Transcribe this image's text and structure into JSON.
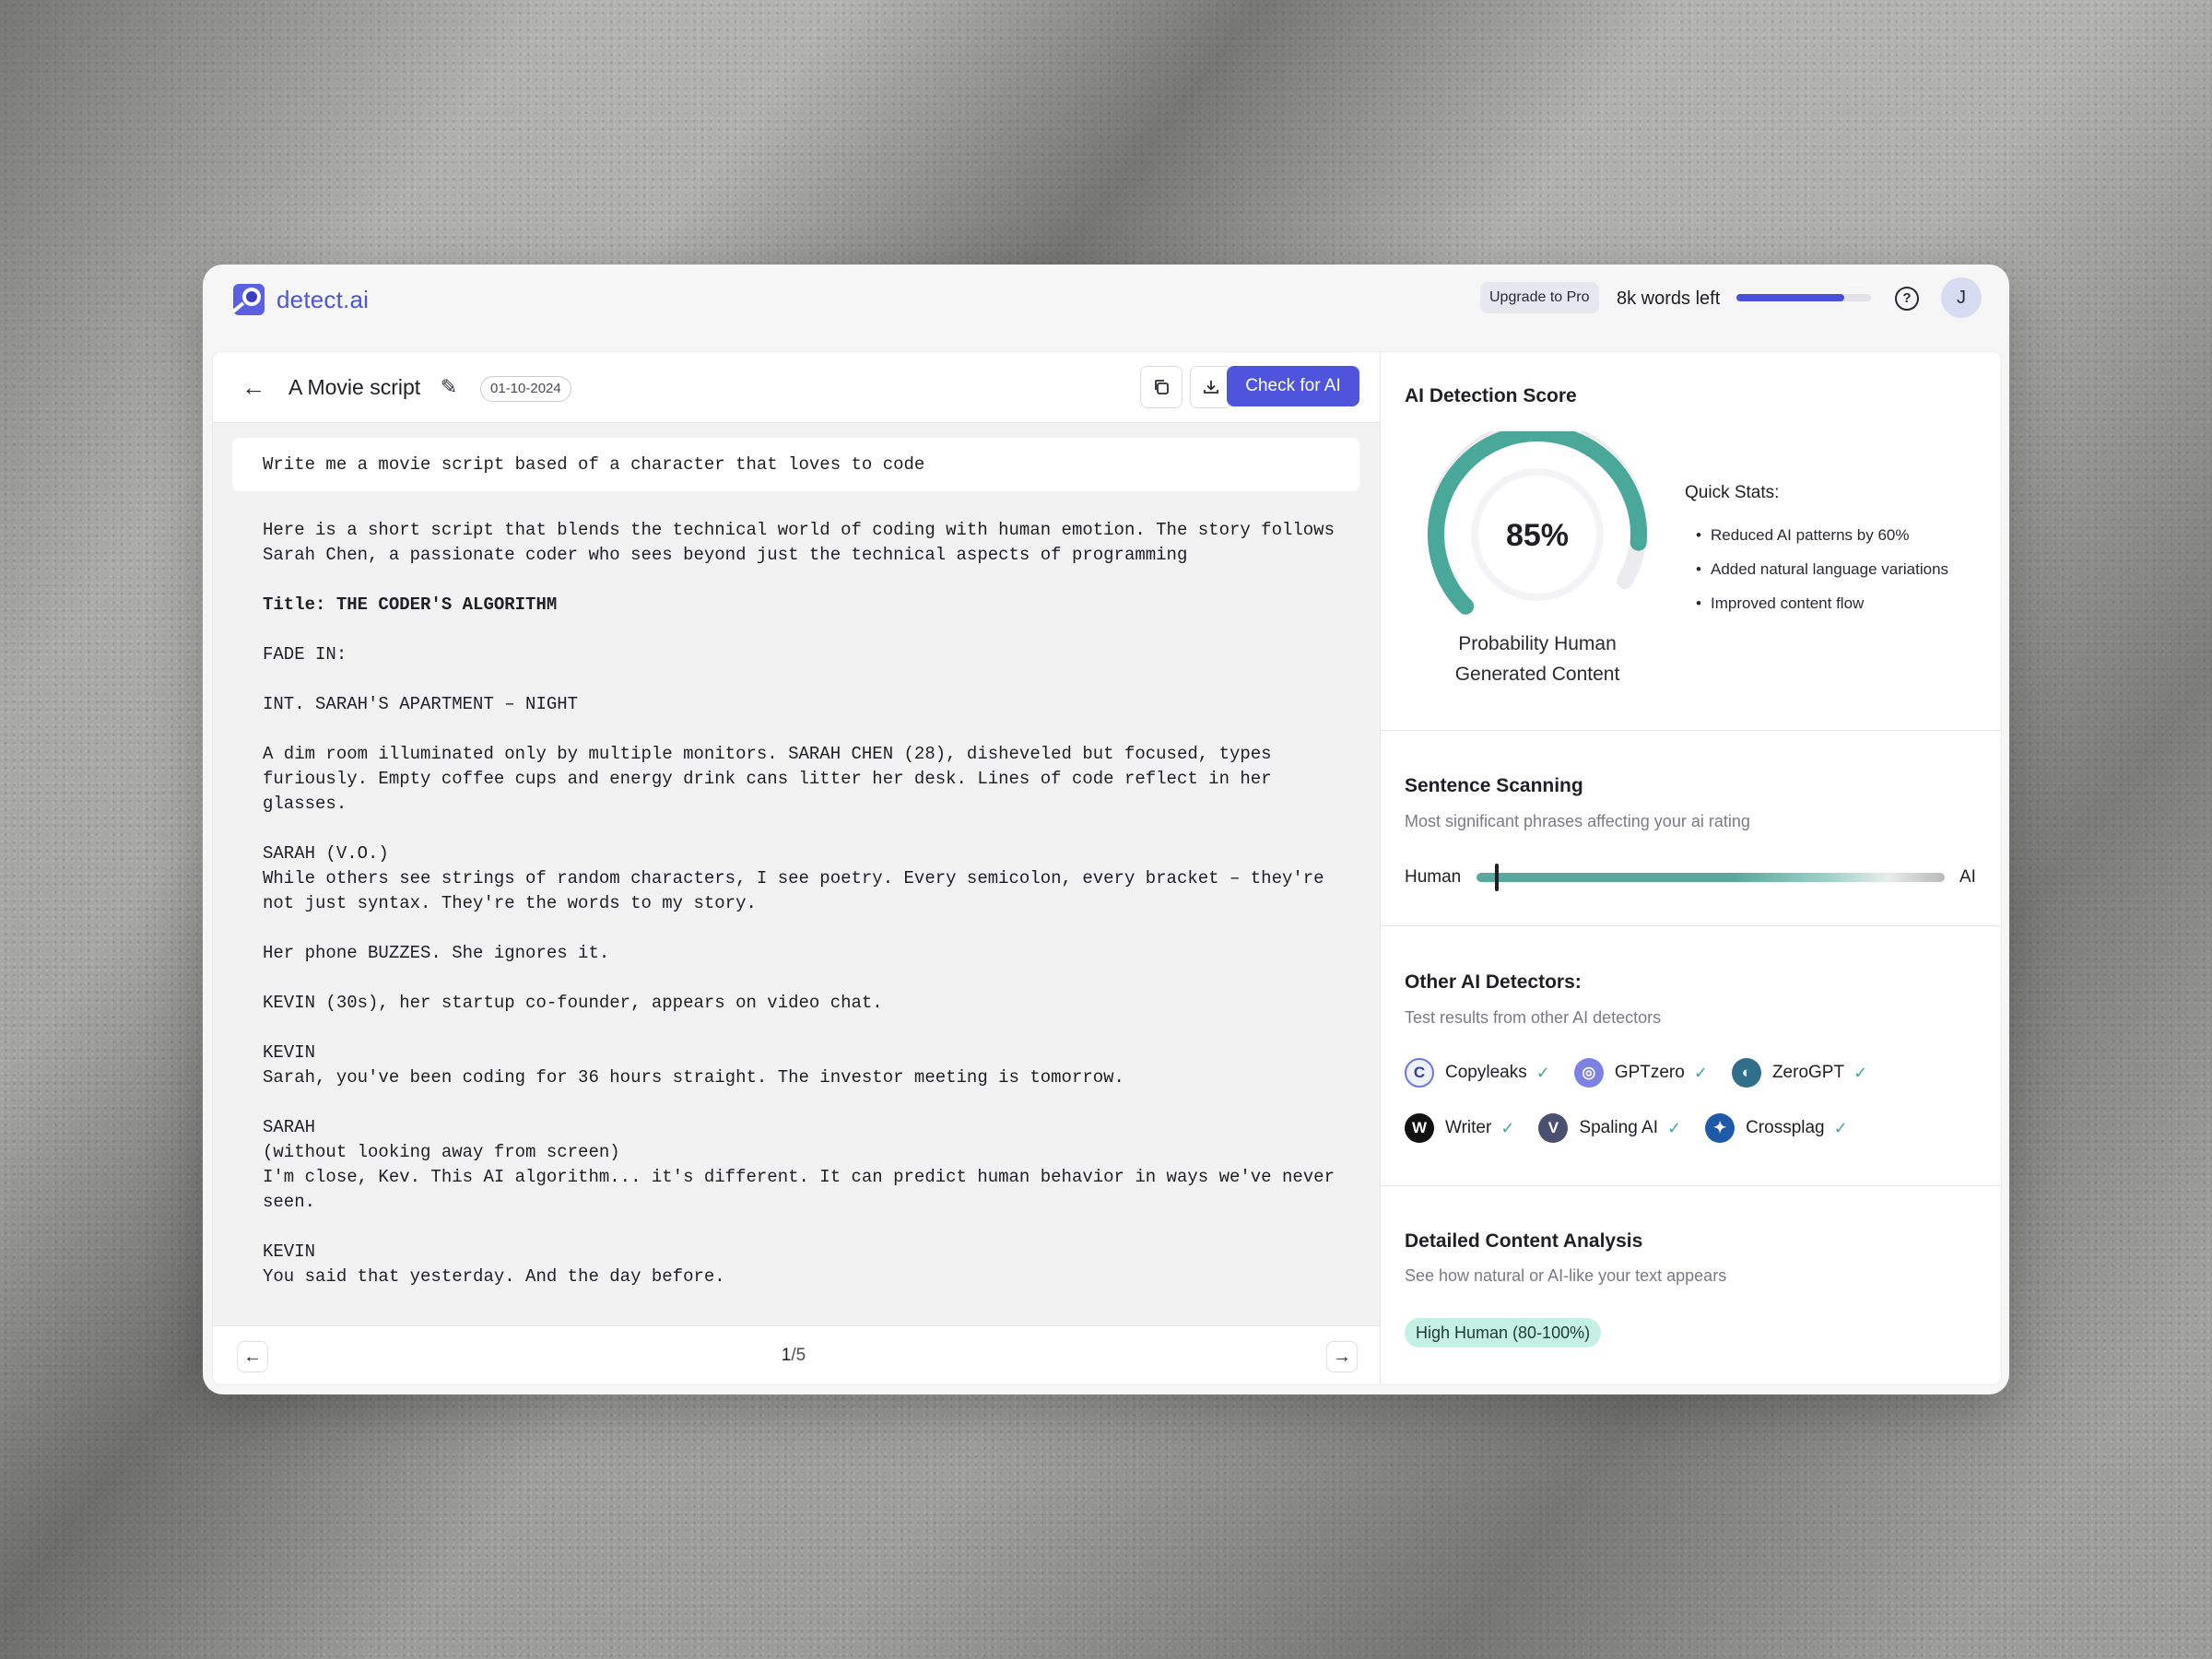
{
  "app": {
    "name": "detect.ai"
  },
  "header": {
    "upgrade_label": "Upgrade to Pro",
    "words_left": "8k words left",
    "words_left_fraction": 0.8,
    "help_icon": "help-circle-icon",
    "avatar_initial": "J"
  },
  "document": {
    "title": "A Movie script",
    "date": "01-10-2024",
    "check_label": "Check for AI",
    "prompt": "Write me a movie script based of a character that loves to code",
    "paragraphs": [
      "Here is a short script that blends the technical world of coding with human emotion. The story follows Sarah Chen, a passionate coder who sees beyond just the technical aspects of programming",
      "Title: THE CODER'S ALGORITHM",
      "FADE IN:",
      "INT. SARAH'S APARTMENT – NIGHT",
      "A dim room illuminated only by multiple monitors. SARAH CHEN (28), disheveled but focused, types furiously. Empty coffee cups and energy drink cans litter her desk. Lines of code reflect in her glasses.",
      "SARAH (V.O.)\nWhile others see strings of random characters, I see poetry. Every semicolon, every bracket – they're not just syntax. They're the words to my story.",
      "Her phone BUZZES. She ignores it.",
      "KEVIN (30s), her startup co-founder, appears on video chat.",
      "KEVIN\nSarah, you've been coding for 36 hours straight. The investor meeting is tomorrow.",
      "SARAH\n(without looking away from screen)\nI'm close, Kev. This AI algorithm... it's different. It can predict human behavior in ways we've never seen.",
      "KEVIN\nYou said that yesterday. And the day before."
    ],
    "page_current": "1",
    "page_total": "/5"
  },
  "score": {
    "title": "AI Detection Score",
    "percent_label": "85%",
    "percent_value": 85,
    "caption": "Probability Human Generated Content",
    "quick_stats_title": "Quick Stats:",
    "quick_stats": [
      "Reduced AI patterns by 60%",
      "Added natural language variations",
      "Improved content flow"
    ],
    "accent_color": "#4aa89a"
  },
  "scanning": {
    "title": "Sentence Scanning",
    "subtitle": "Most significant phrases affecting your ai rating",
    "left_label": "Human",
    "right_label": "AI",
    "position_fraction": 0.04
  },
  "detectors": {
    "title": "Other AI Detectors:",
    "subtitle": "Test results from other AI detectors",
    "row1": [
      {
        "name": "Copyleaks",
        "icon": "copyleaks-icon"
      },
      {
        "name": "GPTzero",
        "icon": "gptzero-icon"
      },
      {
        "name": "ZeroGPT",
        "icon": "zerogpt-icon"
      }
    ],
    "row2": [
      {
        "name": "Writer",
        "icon": "writer-icon"
      },
      {
        "name": "Spaling AI",
        "icon": "spaling-icon"
      },
      {
        "name": "Crossplag",
        "icon": "crossplag-icon"
      }
    ]
  },
  "analysis": {
    "title": "Detailed Content Analysis",
    "subtitle": "See how natural or AI-like your text appears",
    "badge": "High Human (80-100%)",
    "badge_color": "#c5f1e4"
  }
}
